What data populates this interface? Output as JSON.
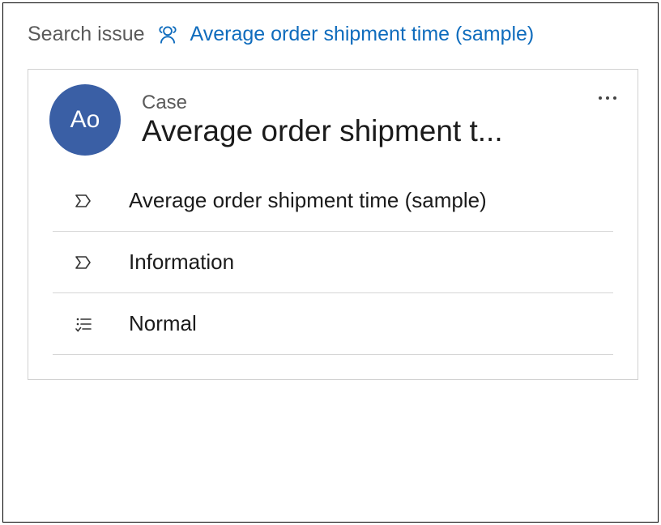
{
  "breadcrumb": {
    "label": "Search issue",
    "link": "Average order shipment time (sample)"
  },
  "card": {
    "avatar_initials": "Ao",
    "type_label": "Case",
    "title": "Average order shipment t...",
    "rows": [
      {
        "text": "Average order shipment time (sample)"
      },
      {
        "text": "Information"
      },
      {
        "text": "Normal"
      }
    ]
  },
  "colors": {
    "accent": "#0f6cbd",
    "avatar_bg": "#3a5fa5"
  }
}
